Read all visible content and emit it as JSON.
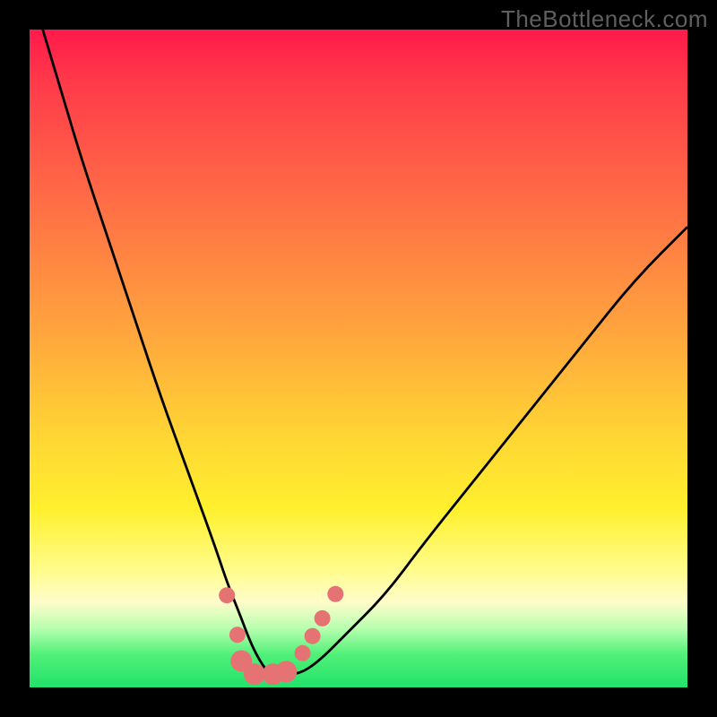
{
  "watermark": "TheBottleneck.com",
  "chart_data": {
    "type": "line",
    "title": "",
    "xlabel": "",
    "ylabel": "",
    "xlim": [
      0,
      100
    ],
    "ylim": [
      0,
      100
    ],
    "series": [
      {
        "name": "curve",
        "color": "#000000",
        "x": [
          2,
          5,
          8,
          12,
          16,
          20,
          24,
          28,
          30,
          32,
          33.5,
          35,
          36.5,
          38,
          41,
          44,
          48,
          54,
          60,
          68,
          76,
          84,
          92,
          100
        ],
        "y": [
          100,
          90,
          80,
          68,
          56,
          44,
          33,
          22,
          16,
          11,
          7,
          4,
          2,
          2,
          2,
          4,
          8,
          14,
          22,
          32,
          42,
          52,
          62,
          70
        ]
      }
    ],
    "markers": {
      "name": "highlight-points",
      "color": "#e57373",
      "radius_small": 9,
      "radius_large": 12,
      "points": [
        {
          "x": 30.0,
          "y": 14.0,
          "r": "small"
        },
        {
          "x": 31.6,
          "y": 8.0,
          "r": "small"
        },
        {
          "x": 32.2,
          "y": 4.0,
          "r": "large"
        },
        {
          "x": 34.2,
          "y": 2.0,
          "r": "large"
        },
        {
          "x": 37.0,
          "y": 2.0,
          "r": "large"
        },
        {
          "x": 39.0,
          "y": 2.4,
          "r": "large"
        },
        {
          "x": 41.5,
          "y": 5.2,
          "r": "small"
        },
        {
          "x": 43.0,
          "y": 7.8,
          "r": "small"
        },
        {
          "x": 44.5,
          "y": 10.5,
          "r": "small"
        },
        {
          "x": 46.5,
          "y": 14.2,
          "r": "small"
        }
      ]
    },
    "gradient_stops": [
      {
        "pos": 0.0,
        "color": "#ff1a4a"
      },
      {
        "pos": 0.08,
        "color": "#ff3a4a"
      },
      {
        "pos": 0.25,
        "color": "#ff6a46"
      },
      {
        "pos": 0.45,
        "color": "#ffa23e"
      },
      {
        "pos": 0.62,
        "color": "#ffd634"
      },
      {
        "pos": 0.73,
        "color": "#fff02e"
      },
      {
        "pos": 0.82,
        "color": "#fffc8a"
      },
      {
        "pos": 0.87,
        "color": "#fffcca"
      },
      {
        "pos": 0.91,
        "color": "#b8ffb0"
      },
      {
        "pos": 0.95,
        "color": "#50f078"
      },
      {
        "pos": 1.0,
        "color": "#22e26a"
      }
    ]
  }
}
